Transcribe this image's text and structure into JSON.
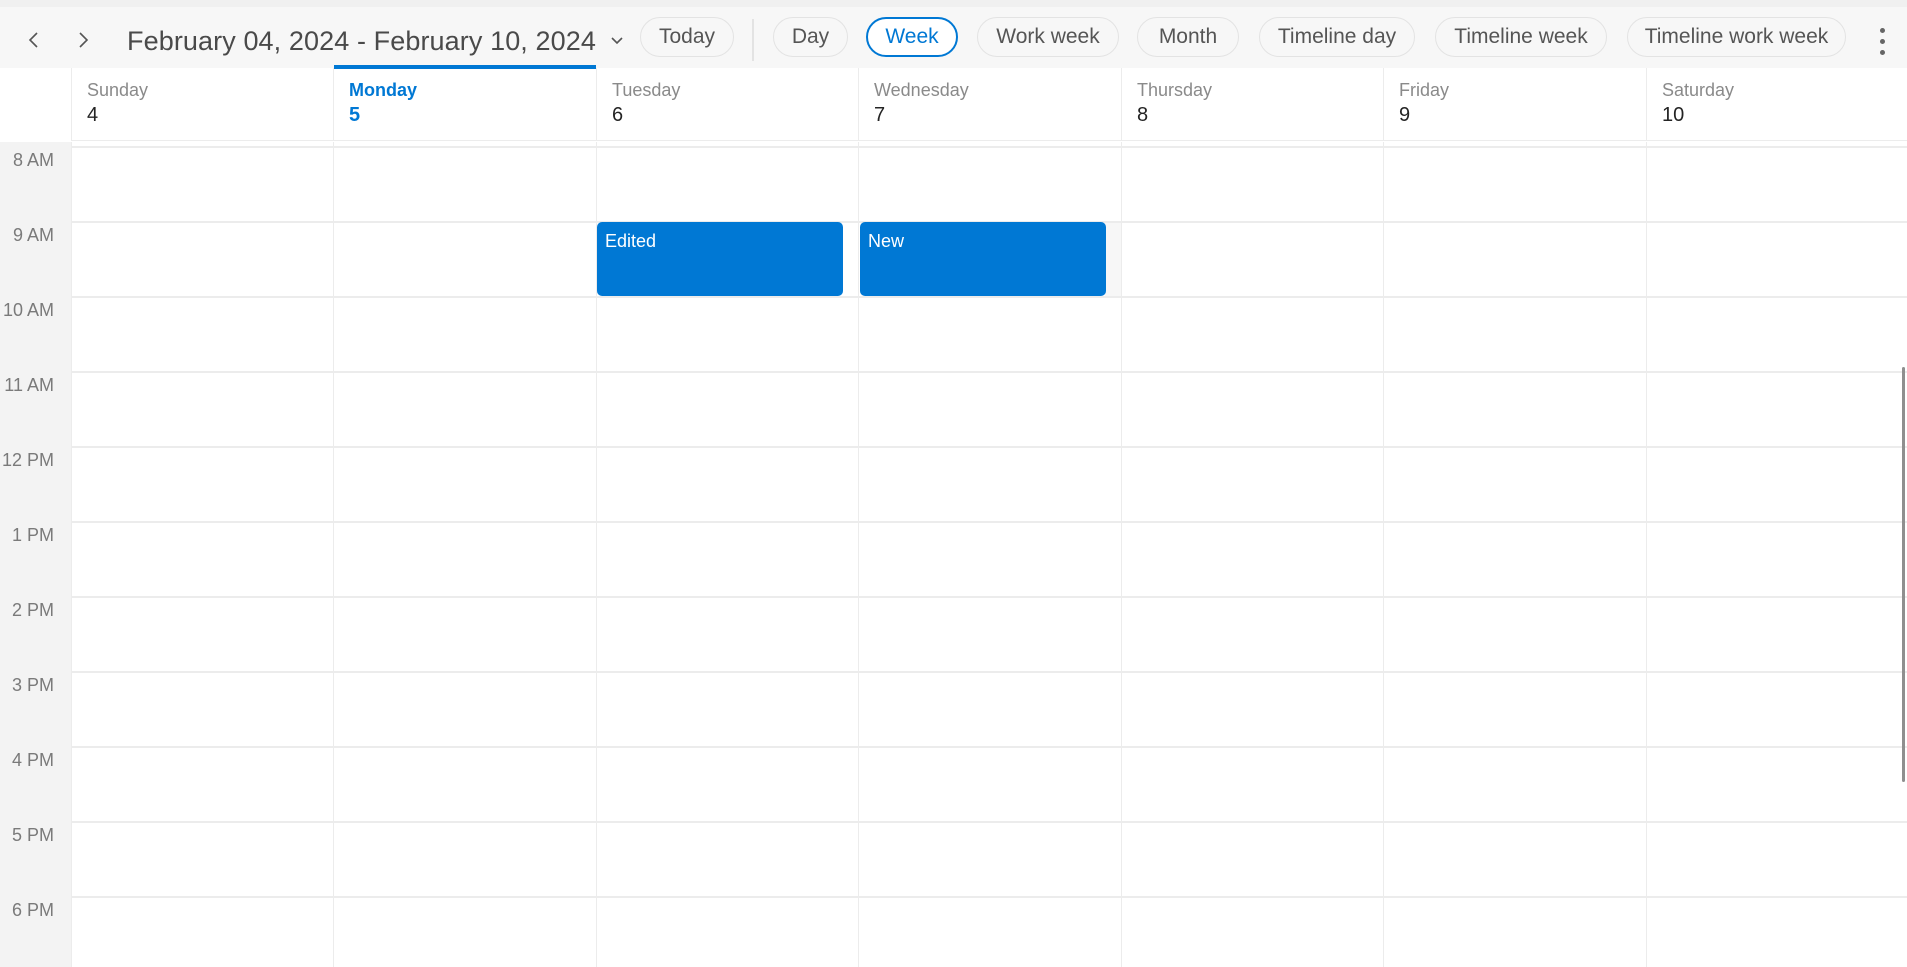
{
  "toolbar": {
    "prev_icon": "chevron-left-icon",
    "next_icon": "chevron-right-icon",
    "date_range": "February 04, 2024 - February 10, 2024",
    "date_range_dropdown_icon": "chevron-down-icon",
    "today_label": "Today",
    "views": [
      {
        "label": "Day",
        "active": false
      },
      {
        "label": "Week",
        "active": true
      },
      {
        "label": "Work week",
        "active": false
      },
      {
        "label": "Month",
        "active": false
      },
      {
        "label": "Timeline day",
        "active": false
      },
      {
        "label": "Timeline week",
        "active": false
      },
      {
        "label": "Timeline work week",
        "active": false
      }
    ],
    "more_icon": "more-vertical-icon"
  },
  "days": [
    {
      "name": "Sunday",
      "num": "4",
      "today": false
    },
    {
      "name": "Monday",
      "num": "5",
      "today": true
    },
    {
      "name": "Tuesday",
      "num": "6",
      "today": false
    },
    {
      "name": "Wednesday",
      "num": "7",
      "today": false
    },
    {
      "name": "Thursday",
      "num": "8",
      "today": false
    },
    {
      "name": "Friday",
      "num": "9",
      "today": false
    },
    {
      "name": "Saturday",
      "num": "10",
      "today": false
    }
  ],
  "time_labels": [
    "8 AM",
    "9 AM",
    "10 AM",
    "11 AM",
    "12 PM",
    "1 PM",
    "2 PM",
    "3 PM",
    "4 PM",
    "5 PM",
    "6 PM"
  ],
  "events": [
    {
      "title": "Edited",
      "day": "Tuesday",
      "start": "9 AM",
      "end": "10 AM"
    },
    {
      "title": "New",
      "day": "Wednesday",
      "start": "9 AM",
      "end": "10 AM"
    }
  ],
  "colors": {
    "accent": "#0078d4",
    "event_bg": "#0078d4",
    "gutter_bg": "#f3f3f3",
    "grid_line": "#ececec"
  }
}
